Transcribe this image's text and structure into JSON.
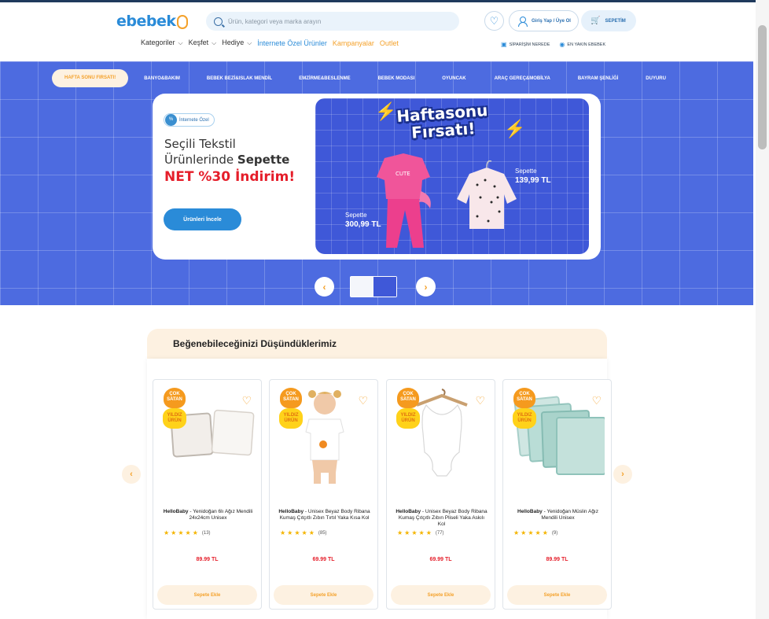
{
  "header": {
    "logo_text": "ebebek",
    "search_placeholder": "Ürün, kategori veya marka arayın",
    "login_label": "Giriş Yap / Üye Ol",
    "cart_label": "SEPETİM",
    "nav": [
      {
        "label": "Kategoriler",
        "has_chevron": true
      },
      {
        "label": "Keşfet",
        "has_chevron": true
      },
      {
        "label": "Hediye",
        "has_chevron": true
      },
      {
        "label": "İnternete Özel Ürünler"
      },
      {
        "label": "Kampanyalar"
      },
      {
        "label": "Outlet"
      }
    ],
    "sublinks": [
      "SİPARİŞİM NEREDE",
      "EN YAKIN EBEBEK"
    ]
  },
  "hero": {
    "categories": [
      "HAFTA SONU FIRSATI!",
      "BANYO&BAKIM",
      "BEBEK BEZİ&ISLAK MENDİL",
      "EMZİRME&BESLENME",
      "BEBEK MODASI",
      "OYUNCAK",
      "ARAÇ GEREÇ&MOBİLYA",
      "BAYRAM ŞENLİĞİ",
      "DUYURU"
    ],
    "badge": "İnternete Özel",
    "headline_line1": "Seçili Tekstil",
    "headline_line2_pre": "Ürünlerinde ",
    "headline_line2_bold": "Sepette",
    "headline_red": "NET %30 İndirim!",
    "cta": "Ürünleri İncele",
    "promo_title_1": "Haftasonu",
    "promo_title_2": "Fırsatı!",
    "price1_label": "Sepette",
    "price1_value": "300,99 TL",
    "price2_label": "Sepette",
    "price2_value": "139,99 TL",
    "shirt_text": "CUTE",
    "colors": {
      "background": "#4d6be0",
      "accent": "#f4a12a",
      "red": "#e51e2a"
    }
  },
  "recs": {
    "title": "Beğenebileceğinizi Düşündüklerimiz",
    "best_seller": "ÇOK SATAN",
    "star_product": "YILDIZ ÜRÜN",
    "add_label": "Sepete Ekle",
    "products": [
      {
        "brand": "HelloBaby",
        "name": " - Yenidoğan 6lı Ağız Mendili 24x24cm Unisex",
        "rating_count": "(13)",
        "price": "89.99 TL"
      },
      {
        "brand": "HelloBaby",
        "name": " - Unisex Beyaz Body Ribana Kumaş Çıtçıtlı Zıbın Tırtıl Yaka Kısa Kol",
        "rating_count": "(85)",
        "price": "69.99 TL"
      },
      {
        "brand": "HelloBaby",
        "name": " - Unisex Beyaz Body Ribana Kumaş Çıtçıtlı Zıbın Pliseli Yaka Askılı Kol",
        "rating_count": "(77)",
        "price": "69.99 TL"
      },
      {
        "brand": "HelloBaby",
        "name": " - Yenidoğan Müslin Ağız Mendili Unisex",
        "rating_count": "(9)",
        "price": "89.99 TL"
      }
    ]
  }
}
